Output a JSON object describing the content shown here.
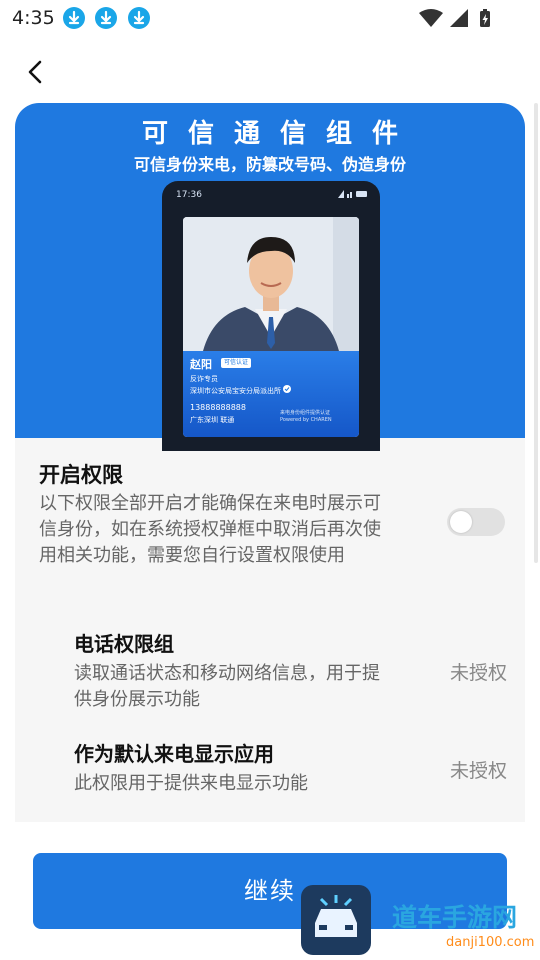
{
  "status_bar": {
    "time": "4:35",
    "notification_icons": [
      "download-icon",
      "download-icon",
      "download-icon"
    ],
    "system_icons": [
      "wifi-icon",
      "cell-signal-icon",
      "battery-charging-icon"
    ]
  },
  "nav": {
    "back_icon": "chevron-left-icon"
  },
  "hero": {
    "title": "可信通信组件",
    "subtitle": "可信身份来电，防篡改号码、伪造身份",
    "phone": {
      "time": "17:36",
      "caller_name": "赵阳",
      "badge": "可信认证",
      "role": "反诈专员",
      "org": "深圳市公安局宝安分局派出所",
      "number": "13888888888",
      "location": "广东深圳 联通",
      "powered_line1": "来电身份组件提供认证",
      "powered_line2": "Powered by CHAREN"
    }
  },
  "permissions": {
    "title": "开启权限",
    "description": "以下权限全部开启才能确保在来电时展示可信身份，如在系统授权弹框中取消后再次使用相关功能，需要您自行设置权限使用",
    "master_toggle_on": false,
    "items": [
      {
        "title": "电话权限组",
        "description": "读取通话状态和移动网络信息，用于提供身份展示功能",
        "status": "未授权"
      },
      {
        "title": "作为默认来电显示应用",
        "description": "此权限用于提供来电显示功能",
        "status": "未授权"
      }
    ]
  },
  "continue_button": {
    "label": "继续"
  },
  "watermark": {
    "text": "道车手游网",
    "sub": "danji100.com"
  },
  "colors": {
    "accent": "#1f79e0",
    "card_bg": "#f6f6f6"
  }
}
